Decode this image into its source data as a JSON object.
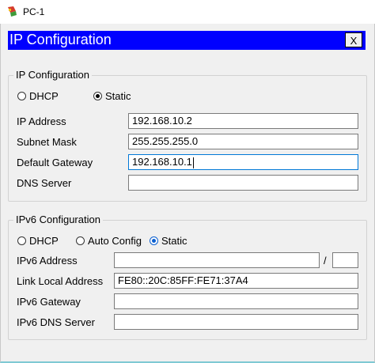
{
  "window": {
    "title": "PC-1"
  },
  "dialog": {
    "title": "IP Configuration",
    "close_label": "X"
  },
  "ipv4": {
    "legend": "IP Configuration",
    "mode_options": [
      "DHCP",
      "Static"
    ],
    "selected_mode": "Static",
    "fields": [
      {
        "label": "IP Address",
        "value": "192.168.10.2"
      },
      {
        "label": "Subnet Mask",
        "value": "255.255.255.0"
      },
      {
        "label": "Default Gateway",
        "value": "192.168.10.1"
      },
      {
        "label": "DNS Server",
        "value": ""
      }
    ]
  },
  "ipv6": {
    "legend": "IPv6 Configuration",
    "mode_options": [
      "DHCP",
      "Auto Config",
      "Static"
    ],
    "selected_mode": "Static",
    "address_label": "IPv6 Address",
    "address_value": "",
    "prefix_separator": "/",
    "prefix_value": "",
    "link_local_label": "Link Local Address",
    "link_local_value": "FE80::20C:85FF:FE71:37A4",
    "gateway_label": "IPv6 Gateway",
    "gateway_value": "",
    "dns_label": "IPv6 DNS Server",
    "dns_value": ""
  },
  "colors": {
    "header_bg": "#0000ff",
    "focus_border": "#0078d7",
    "selected_radio": "#0a5fd0"
  }
}
